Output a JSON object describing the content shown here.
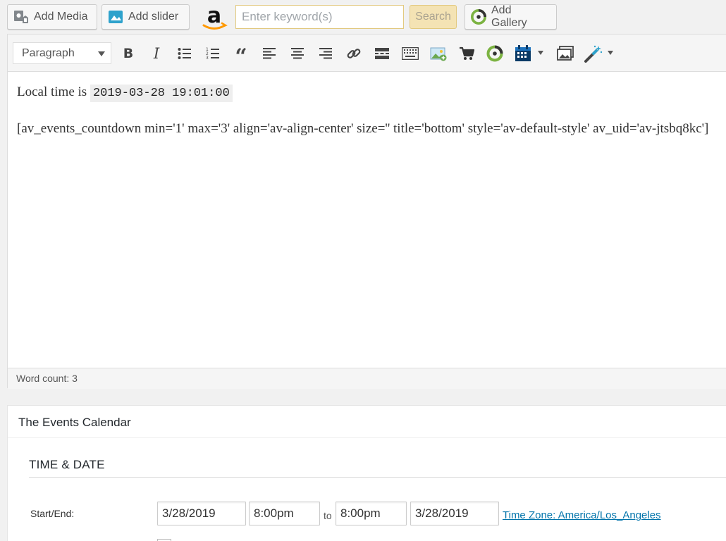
{
  "media_bar": {
    "add_media": "Add Media",
    "add_slider": "Add slider",
    "keyword_placeholder": "Enter keyword(s)",
    "search": "Search",
    "add_gallery": "Add Gallery"
  },
  "toolbar": {
    "format": "Paragraph"
  },
  "content": {
    "local_time_label": "Local time is ",
    "local_time_value": "2019-03-28 19:01:00",
    "shortcode": "[av_events_countdown min='1' max='3' align='av-align-center' size='' title='bottom' style='av-default-style' av_uid='av-jtsbq8kc']"
  },
  "status": {
    "word_count": "Word count: 3"
  },
  "events_calendar": {
    "title": "The Events Calendar",
    "section": "TIME & DATE",
    "start_end_label": "Start/End:",
    "start_date": "3/28/2019",
    "start_time": "8:00pm",
    "to": "to",
    "end_time": "8:00pm",
    "end_date": "3/28/2019",
    "timezone": "Time Zone: America/Los_Angeles"
  },
  "colors": {
    "link": "#0073aa",
    "amazon_orange": "#f90",
    "teal": "#2ea2cc"
  }
}
